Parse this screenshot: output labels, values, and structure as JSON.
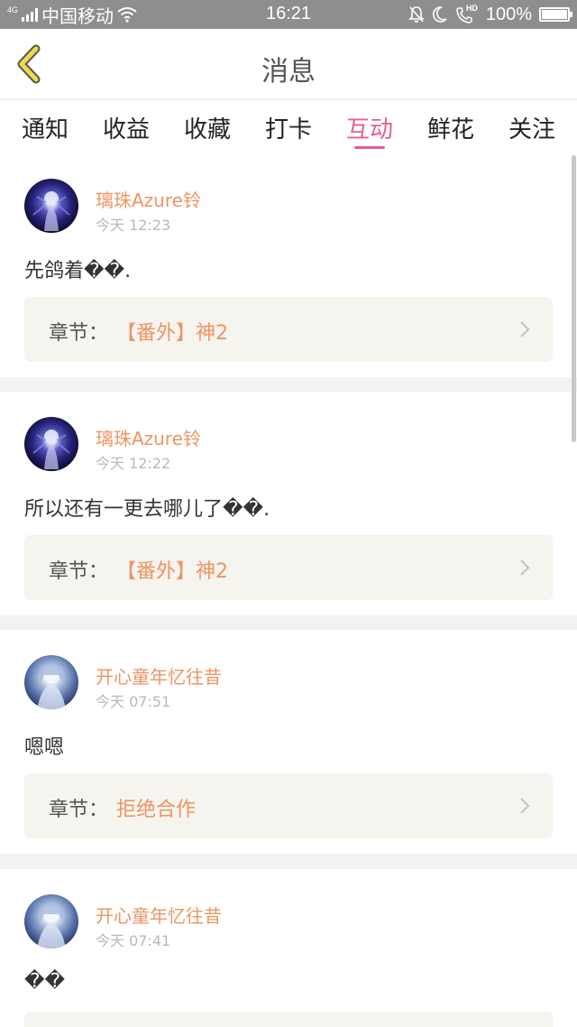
{
  "status_bar": {
    "network": "4G",
    "carrier": "中国移动",
    "time": "16:21",
    "battery": "100%",
    "hd_label": "HD"
  },
  "header": {
    "title": "消息"
  },
  "tabs": [
    {
      "label": "通知"
    },
    {
      "label": "收益"
    },
    {
      "label": "收藏"
    },
    {
      "label": "打卡"
    },
    {
      "label": "互动",
      "active": true
    },
    {
      "label": "鲜花"
    },
    {
      "label": "关注"
    }
  ],
  "messages": [
    {
      "username": "璃珠Azure铃",
      "time": "今天 12:23",
      "content": "先鸽着��.",
      "chapter_prefix": "章节：",
      "chapter_name": "【番外】神2"
    },
    {
      "username": "璃珠Azure铃",
      "time": "今天 12:22",
      "content": "所以还有一更去哪儿了��.",
      "chapter_prefix": "章节：",
      "chapter_name": "【番外】神2"
    },
    {
      "username": "开心童年忆往昔",
      "time": "今天 07:51",
      "content": "嗯嗯",
      "chapter_prefix": "章节：",
      "chapter_name": "拒绝合作"
    },
    {
      "username": "开心童年忆往昔",
      "time": "今天 07:41",
      "content": "��",
      "chapter_prefix": "",
      "chapter_name": ""
    }
  ],
  "colors": {
    "accent_pink": "#e0609a",
    "username_orange": "#ee9462",
    "back_arrow_yellow": "#f0d84a",
    "status_bar_gray": "#8e8e8e"
  }
}
